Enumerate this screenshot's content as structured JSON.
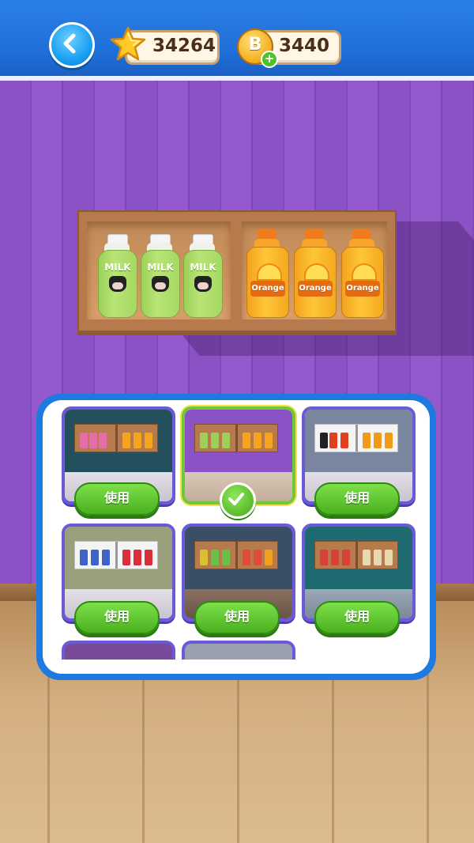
{
  "header": {
    "stars": "34264",
    "coins": "3440",
    "coin_letter": "B",
    "back_icon": "chevron-left-icon",
    "star_icon": "star-icon",
    "coin_icon": "coin-icon",
    "plus_icon": "plus-icon"
  },
  "shelf": {
    "milk_label": "MILK",
    "orange_label": "Orange"
  },
  "panel": {
    "use_label": "使用",
    "selected_index": 1,
    "cards": [
      {
        "theme": "teal-wood",
        "state": "use"
      },
      {
        "theme": "purple-wood",
        "state": "selected"
      },
      {
        "theme": "gray-white",
        "state": "use"
      },
      {
        "theme": "sage-white",
        "state": "use"
      },
      {
        "theme": "slate-wood",
        "state": "use"
      },
      {
        "theme": "teal-wood",
        "state": "use"
      }
    ]
  },
  "colors": {
    "topbar": "#1f6fd8",
    "wall": "#8a52c5",
    "panel_border": "#1e7ae0",
    "button_green": "#4ab01e",
    "card_border": "#6a5ad8",
    "selected_border": "#6ec83a"
  }
}
